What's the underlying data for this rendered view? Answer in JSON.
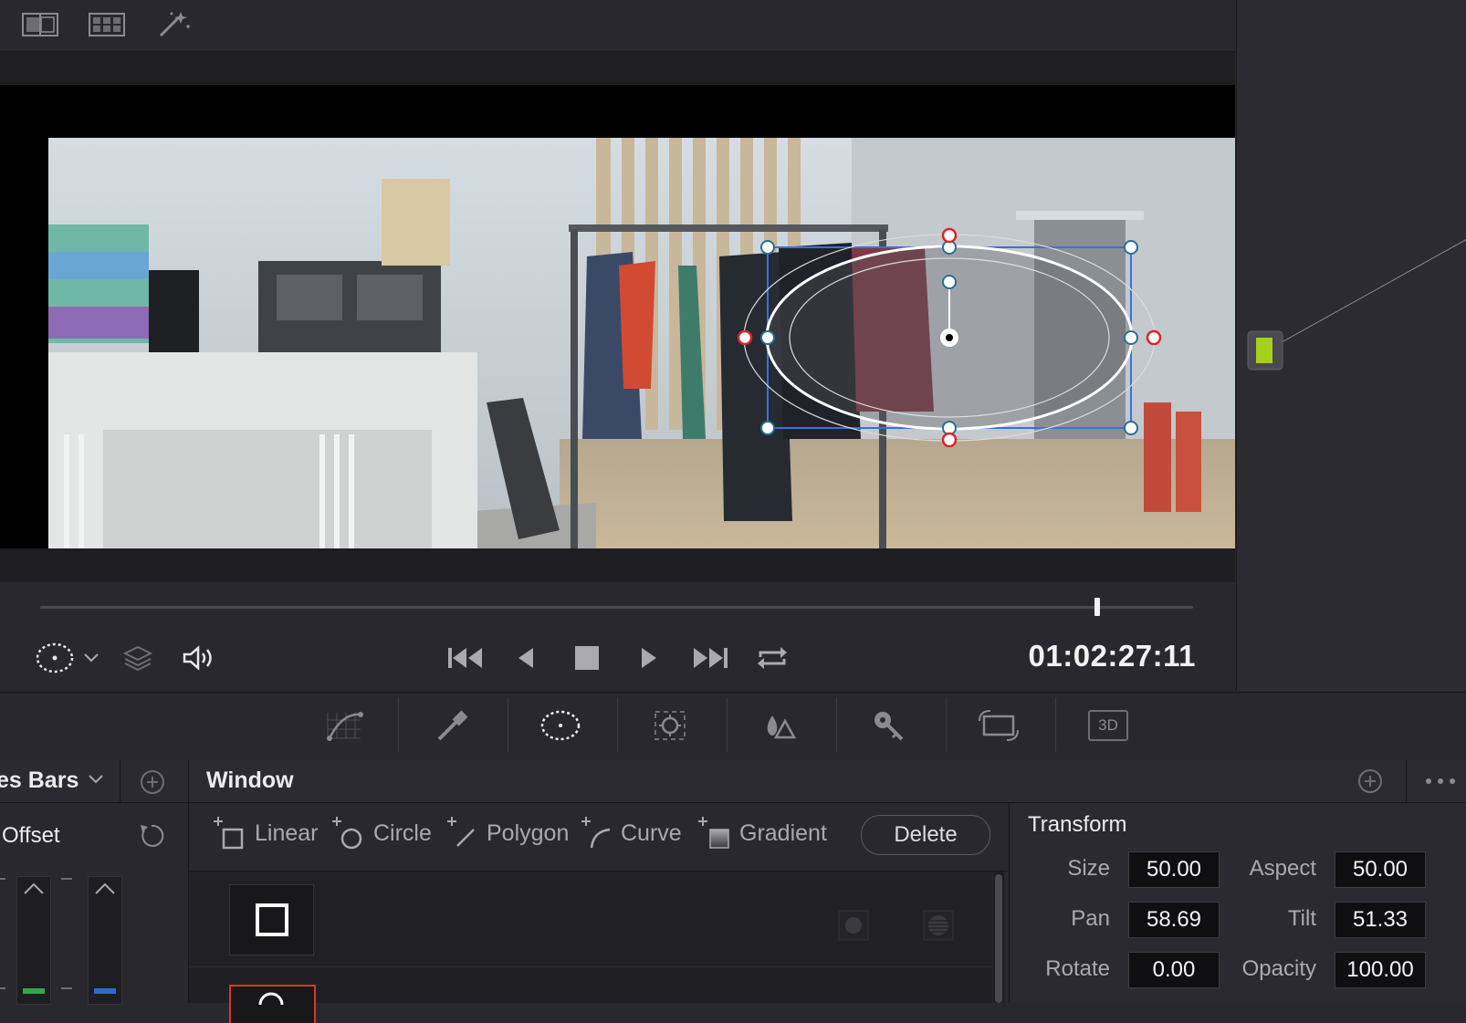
{
  "toolbar": {
    "icons": [
      "split-screen-icon",
      "grid-view-icon",
      "magic-wand-icon"
    ]
  },
  "viewer": {
    "timecode": "01:02:27:11",
    "playhead_fraction": 0.917
  },
  "palette": {
    "tools": [
      "curves-icon",
      "qualifier-picker-icon",
      "window-icon",
      "tracker-icon",
      "magic-mask-icon",
      "key-icon",
      "sizing-icon",
      "3d-icon"
    ],
    "selected": "window-icon",
    "label_3d": "3D"
  },
  "left_panel": {
    "title": "es Bars",
    "section": "Offset"
  },
  "window_panel": {
    "title": "Window",
    "shapes": [
      {
        "label": "Linear"
      },
      {
        "label": "Circle"
      },
      {
        "label": "Polygon"
      },
      {
        "label": "Curve"
      },
      {
        "label": "Gradient"
      }
    ],
    "delete_label": "Delete"
  },
  "transform": {
    "title": "Transform",
    "fields": {
      "size_label": "Size",
      "size": "50.00",
      "aspect_label": "Aspect",
      "aspect": "50.00",
      "pan_label": "Pan",
      "pan": "58.69",
      "tilt_label": "Tilt",
      "tilt": "51.33",
      "rotate_label": "Rotate",
      "rotate": "0.00",
      "opacity_label": "Opacity",
      "opacity": "100.00"
    }
  },
  "colors": {
    "accent_green": "#a6d01b",
    "window_box": "#3a6fe0",
    "handle_red": "#d8262a",
    "selected_thumb_border": "#d03a2c"
  }
}
